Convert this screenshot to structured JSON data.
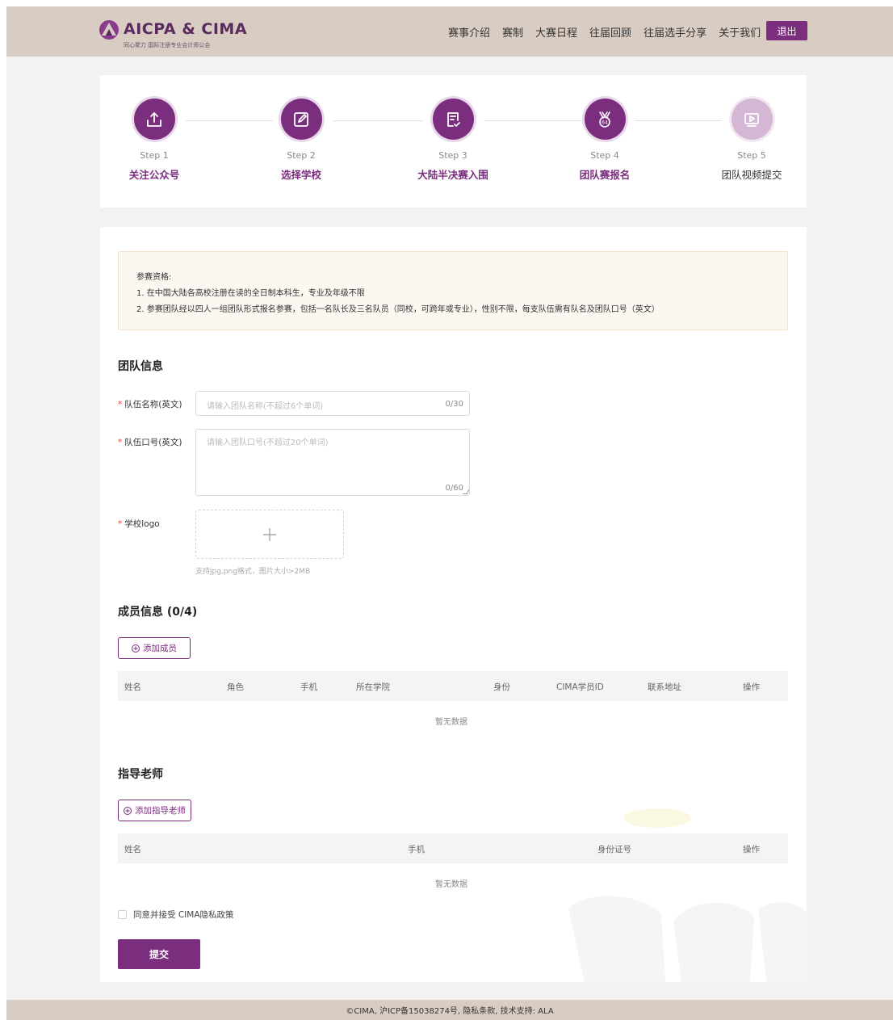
{
  "header": {
    "logo_text": "AICPA & CIMA",
    "logo_sub": "同心聚力  国际注册专业会计师公会",
    "nav": [
      "赛事介绍",
      "赛制",
      "大赛日程",
      "往届回顾",
      "往届选手分享",
      "关于我们"
    ],
    "logout_label": "退出",
    "accent_color": "#7b2d7e"
  },
  "steps": [
    {
      "num": "Step 1",
      "name": "关注公众号",
      "icon": "upload-icon",
      "active": true
    },
    {
      "num": "Step 2",
      "name": "选择学校",
      "icon": "edit-icon",
      "active": true
    },
    {
      "num": "Step 3",
      "name": "大陆半决赛入围",
      "icon": "document-check-icon",
      "active": true
    },
    {
      "num": "Step 4",
      "name": "团队赛报名",
      "icon": "medal-icon",
      "active": true
    },
    {
      "num": "Step 5",
      "name": "团队视频提交",
      "icon": "video-icon",
      "active": false
    }
  ],
  "notice": {
    "title": "参赛资格:",
    "line1": "1. 在中国大陆各高校注册在读的全日制本科生，专业及年级不限",
    "line2": "2. 参赛团队经以四人一组团队形式报名参赛，包括一名队长及三名队员（同校，可跨年或专业），性别不限，每支队伍需有队名及团队口号（英文）"
  },
  "team": {
    "section_title": "团队信息",
    "name_label": "队伍名称(英文)",
    "name_placeholder": "请输入团队名称(不超过6个单词)",
    "name_count": "0/30",
    "slogan_label": "队伍口号(英文)",
    "slogan_placeholder": "请输入团队口号(不超过20个单词)",
    "slogan_count": "0/60",
    "logo_label": "学校logo",
    "upload_tip": "支持jpg,png格式，图片大小>2MB"
  },
  "members": {
    "section_title": "成员信息  (0/4)",
    "add_label": "添加成员",
    "columns": [
      "姓名",
      "角色",
      "手机",
      "所在学院",
      "身份",
      "CIMA学员ID",
      "联系地址",
      "操作"
    ],
    "empty": "暂无数据"
  },
  "advisors": {
    "section_title": "指导老师",
    "add_label": "添加指导老师",
    "columns": [
      "姓名",
      "手机",
      "身份证号",
      "操作"
    ],
    "empty": "暂无数据"
  },
  "agree_label": "同意并接受 CIMA隐私政策",
  "submit_label": "提交",
  "footer_text": "©CIMA, 沪ICP备15038274号, 隐私条款, 技术支持: ALA"
}
